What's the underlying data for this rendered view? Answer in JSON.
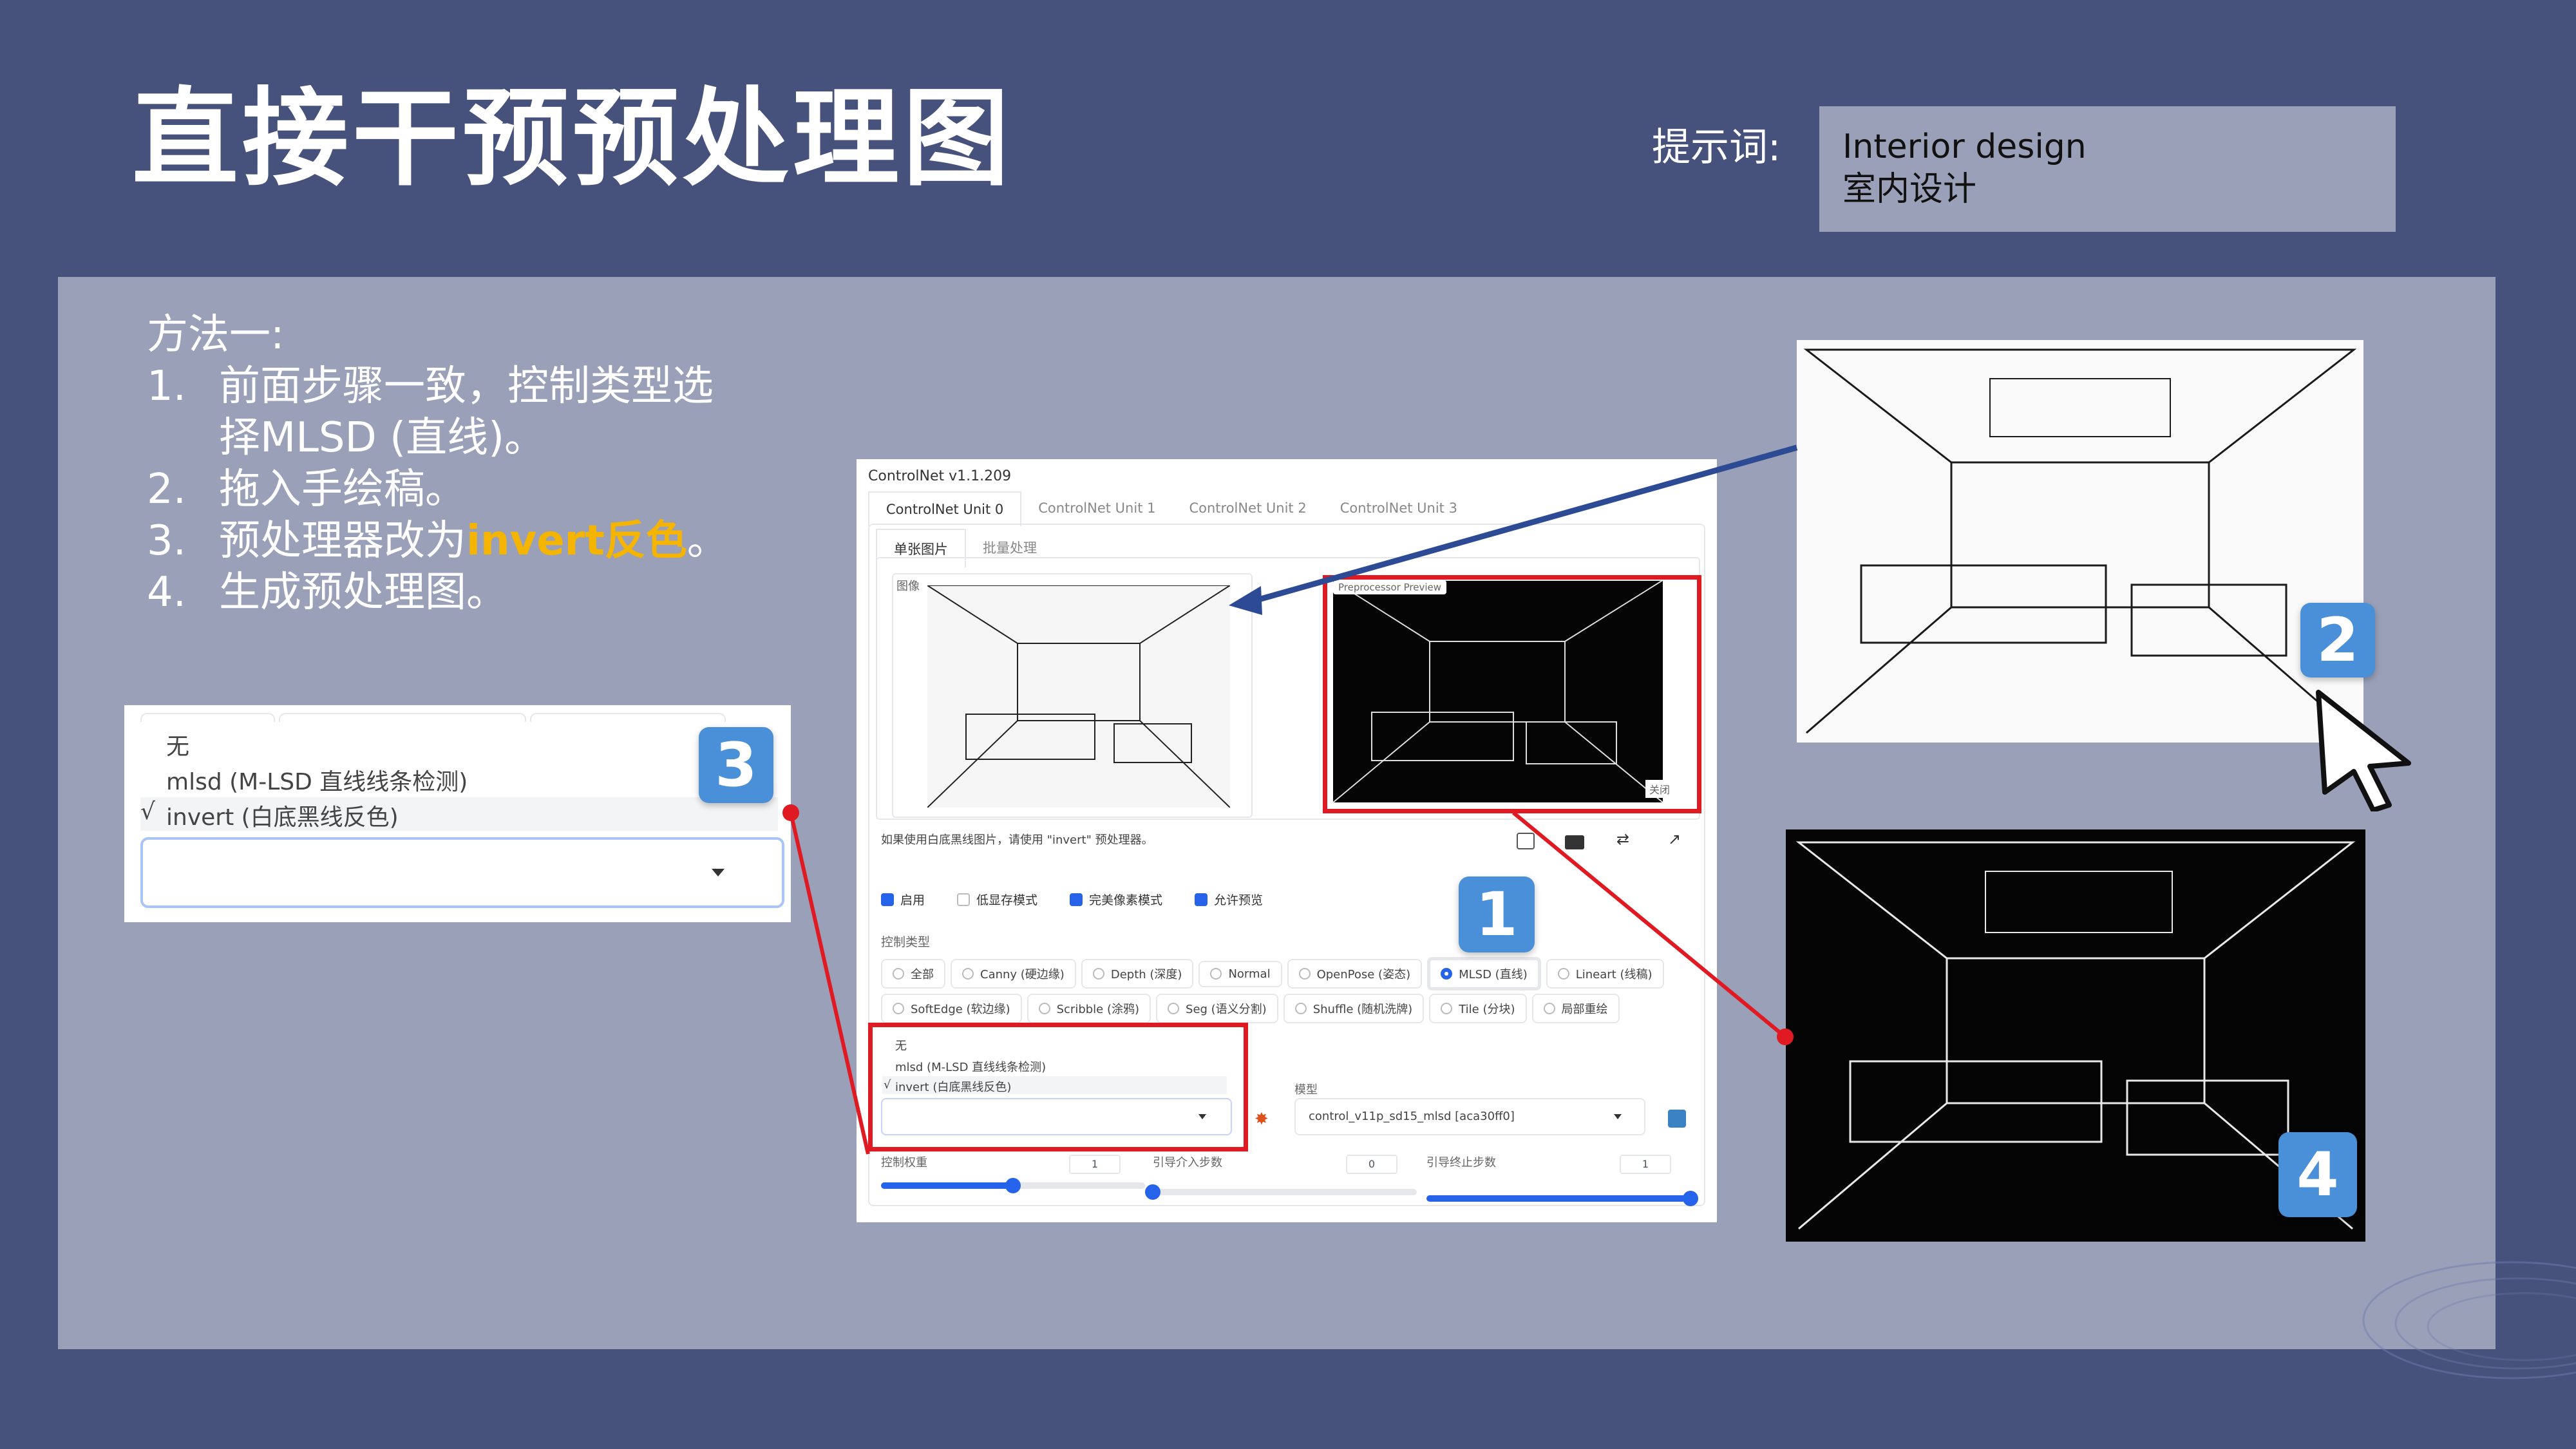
{
  "slide": {
    "title": "直接干预预处理图",
    "prompt_label": "提示词:",
    "prompt_en": "Interior design",
    "prompt_zh": "室内设计"
  },
  "method": {
    "heading": "方法一:",
    "steps": [
      {
        "num": "1.",
        "line1": "前面步骤一致，控制类型选",
        "line2": "择MLSD (直线)。"
      },
      {
        "num": "2.",
        "text": "拖入手绘稿。"
      },
      {
        "num": "3.",
        "text_a": "预处理器改为",
        "text_hl": "invert反色",
        "text_b": "。"
      },
      {
        "num": "4.",
        "text": "生成预处理图。"
      }
    ]
  },
  "badges": {
    "b1": "1",
    "b2": "2",
    "b3": "3",
    "b4": "4"
  },
  "dropdown_zoom": {
    "tabs": [
      "",
      "",
      ""
    ],
    "options": [
      "无",
      "mlsd (M-LSD 直线线条检测)",
      "invert (白底黑线反色)"
    ],
    "check": "√"
  },
  "controlnet": {
    "version": "ControlNet v1.1.209",
    "units": [
      "ControlNet Unit 0",
      "ControlNet Unit 1",
      "ControlNet Unit 2",
      "ControlNet Unit 3"
    ],
    "subtabs": [
      "单张图片",
      "批量处理"
    ],
    "image_label": "图像",
    "preview_label": "Preprocessor Preview",
    "close_label": "关闭",
    "hint": "如果使用白底黑线图片，请使用 \"invert\" 预处理器。",
    "checks": [
      {
        "label": "启用",
        "on": true
      },
      {
        "label": "低显存模式",
        "on": false
      },
      {
        "label": "完美像素模式",
        "on": true
      },
      {
        "label": "允许预览",
        "on": true
      }
    ],
    "control_type_label": "控制类型",
    "types_row1": [
      "全部",
      "Canny (硬边缘)",
      "Depth (深度)",
      "Normal",
      "OpenPose (姿态)",
      "MLSD (直线)",
      "Lineart (线稿)"
    ],
    "types_row2": [
      "SoftEdge (软边缘)",
      "Scribble (涂鸦)",
      "Seg (语义分割)",
      "Shuffle (随机洗牌)",
      "Tile (分块)",
      "局部重绘"
    ],
    "selected_type": "MLSD (直线)",
    "dropdown_options": [
      "无",
      "mlsd (M-LSD 直线线条检测)",
      "invert (白底黑线反色)"
    ],
    "model_label": "模型",
    "model_value": "control_v11p_sd15_mlsd [aca30ff0]",
    "weight_label": "控制权重",
    "weight_value": "1",
    "start_label": "引导介入步数",
    "start_value": "0",
    "end_label": "引导终止步数",
    "end_value": "1",
    "sliders": {
      "weight": 0.5,
      "start": 0.0,
      "end": 1.0
    },
    "icons": [
      "edit-icon",
      "camera-icon",
      "swap-icon",
      "send-icon",
      "explosion-icon",
      "refresh-icon"
    ]
  },
  "colors": {
    "background": "#46527c",
    "panel": "#9aa0b8",
    "accent_red": "#e01a22",
    "highlight": "#f4b400",
    "badge": "#4a90d9"
  }
}
